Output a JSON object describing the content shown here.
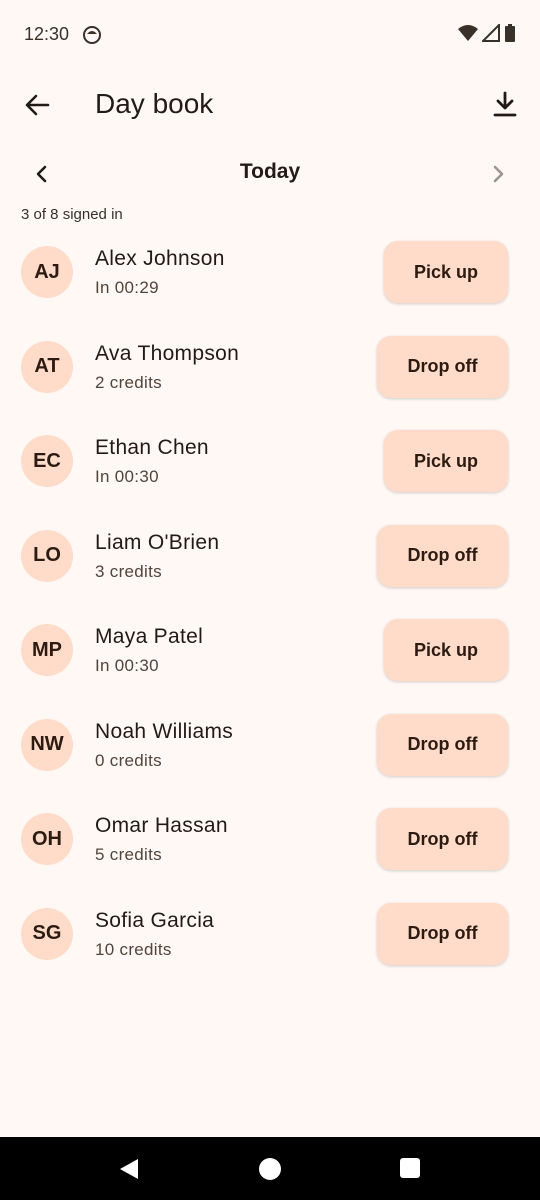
{
  "status": {
    "time": "12:30"
  },
  "app_bar": {
    "title": "Day book"
  },
  "date_nav": {
    "label": "Today"
  },
  "summary": {
    "signed_in": "3 of 8 signed in"
  },
  "children": [
    {
      "initials": "AJ",
      "name": "Alex Johnson",
      "detail": "In 00:29",
      "action": "Pick up"
    },
    {
      "initials": "AT",
      "name": "Ava Thompson",
      "detail": "2 credits",
      "action": "Drop off"
    },
    {
      "initials": "EC",
      "name": "Ethan Chen",
      "detail": "In 00:30",
      "action": "Pick up"
    },
    {
      "initials": "LO",
      "name": "Liam O'Brien",
      "detail": "3 credits",
      "action": "Drop off"
    },
    {
      "initials": "MP",
      "name": "Maya Patel",
      "detail": "In 00:30",
      "action": "Pick up"
    },
    {
      "initials": "NW",
      "name": "Noah Williams",
      "detail": "0 credits",
      "action": "Drop off"
    },
    {
      "initials": "OH",
      "name": "Omar Hassan",
      "detail": "5 credits",
      "action": "Drop off"
    },
    {
      "initials": "SG",
      "name": "Sofia Garcia",
      "detail": "10 credits",
      "action": "Drop off"
    }
  ],
  "colors": {
    "background": "#fff8f4",
    "tonal": "#ffdbc9",
    "text": "#231a15"
  },
  "icons": {
    "back": "arrow-left-icon",
    "download": "download-icon",
    "prev": "chevron-left-icon",
    "next": "chevron-right-icon"
  }
}
